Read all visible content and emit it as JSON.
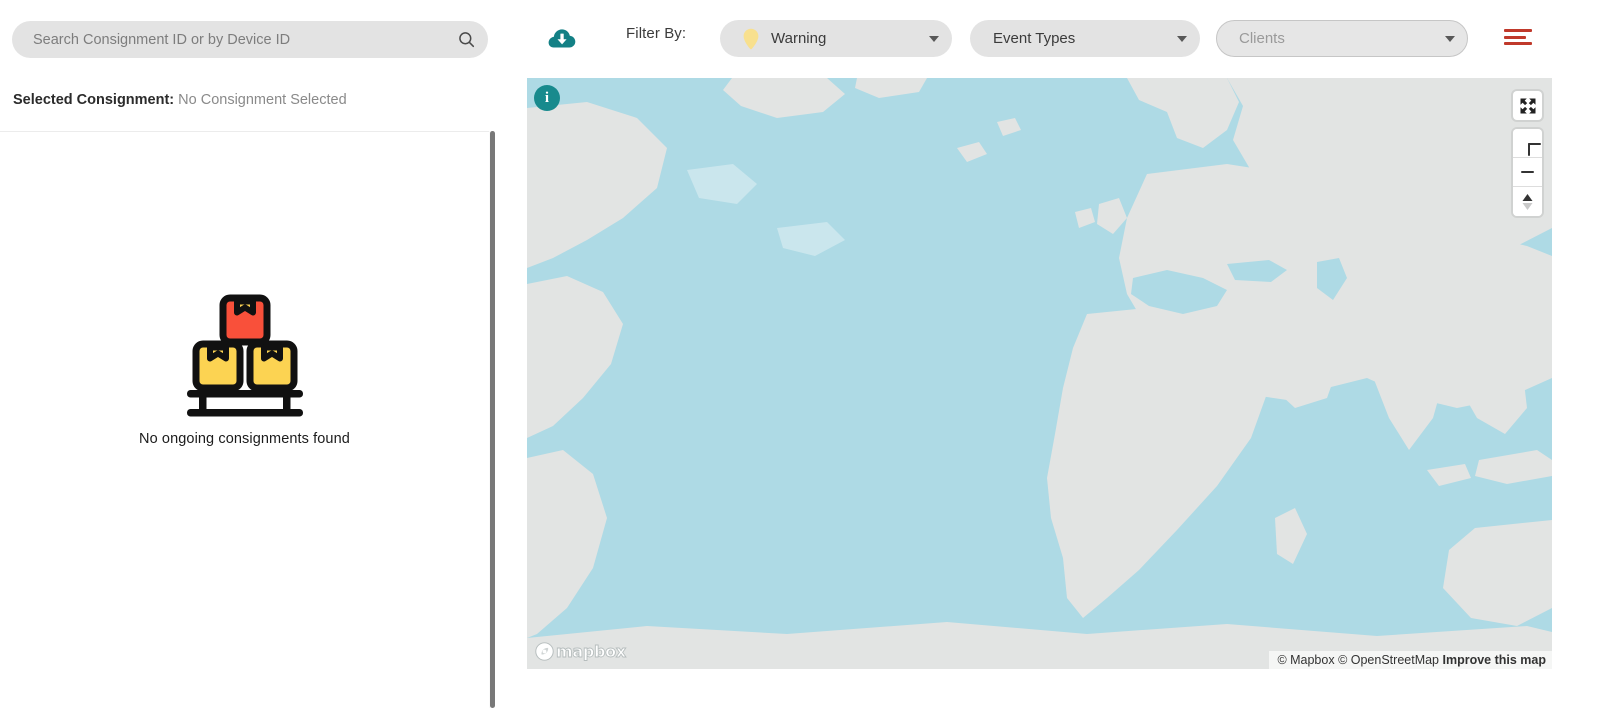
{
  "search": {
    "placeholder": "Search Consignment ID or by Device ID",
    "value": "",
    "icon": "search-icon"
  },
  "toolbar": {
    "download_icon": "cloud-download-icon",
    "filter_by_label": "Filter By:",
    "sort_icon": "sort-filter-list-icon",
    "sort_icon_color": "#c0392b",
    "dropdowns": [
      {
        "name": "severity",
        "value": "Warning",
        "marker_icon": "map-pin-marker-icon",
        "marker_color": "#f8e08e",
        "disabled": false
      },
      {
        "name": "event-types",
        "value": "Event Types",
        "disabled": false
      },
      {
        "name": "clients",
        "value": "Clients",
        "disabled": true
      }
    ]
  },
  "left_panel": {
    "selected_consignment_label": "Selected Consignment:",
    "selected_consignment_value": "No Consignment Selected",
    "empty_state": {
      "illustration": "stacked-boxes-on-pallet-icon",
      "message": "No ongoing consignments found",
      "box_top_color": "#f9503a",
      "box_bottom_color": "#fcd352",
      "tape_color": "#fcd352"
    }
  },
  "map": {
    "info_icon": "info-icon",
    "info_icon_color": "#188a8d",
    "water_color": "#aedae5",
    "land_color": "#e2e4e3",
    "controls": {
      "fullscreen": "fullscreen-expand-icon",
      "zoom_in": "plus-icon",
      "zoom_out": "minus-icon",
      "compass": "compass-reset-north-icon"
    },
    "logo_text": "mapbox",
    "attribution": {
      "mapbox": "© Mapbox",
      "osm": "© OpenStreetMap",
      "improve": "Improve this map"
    }
  }
}
